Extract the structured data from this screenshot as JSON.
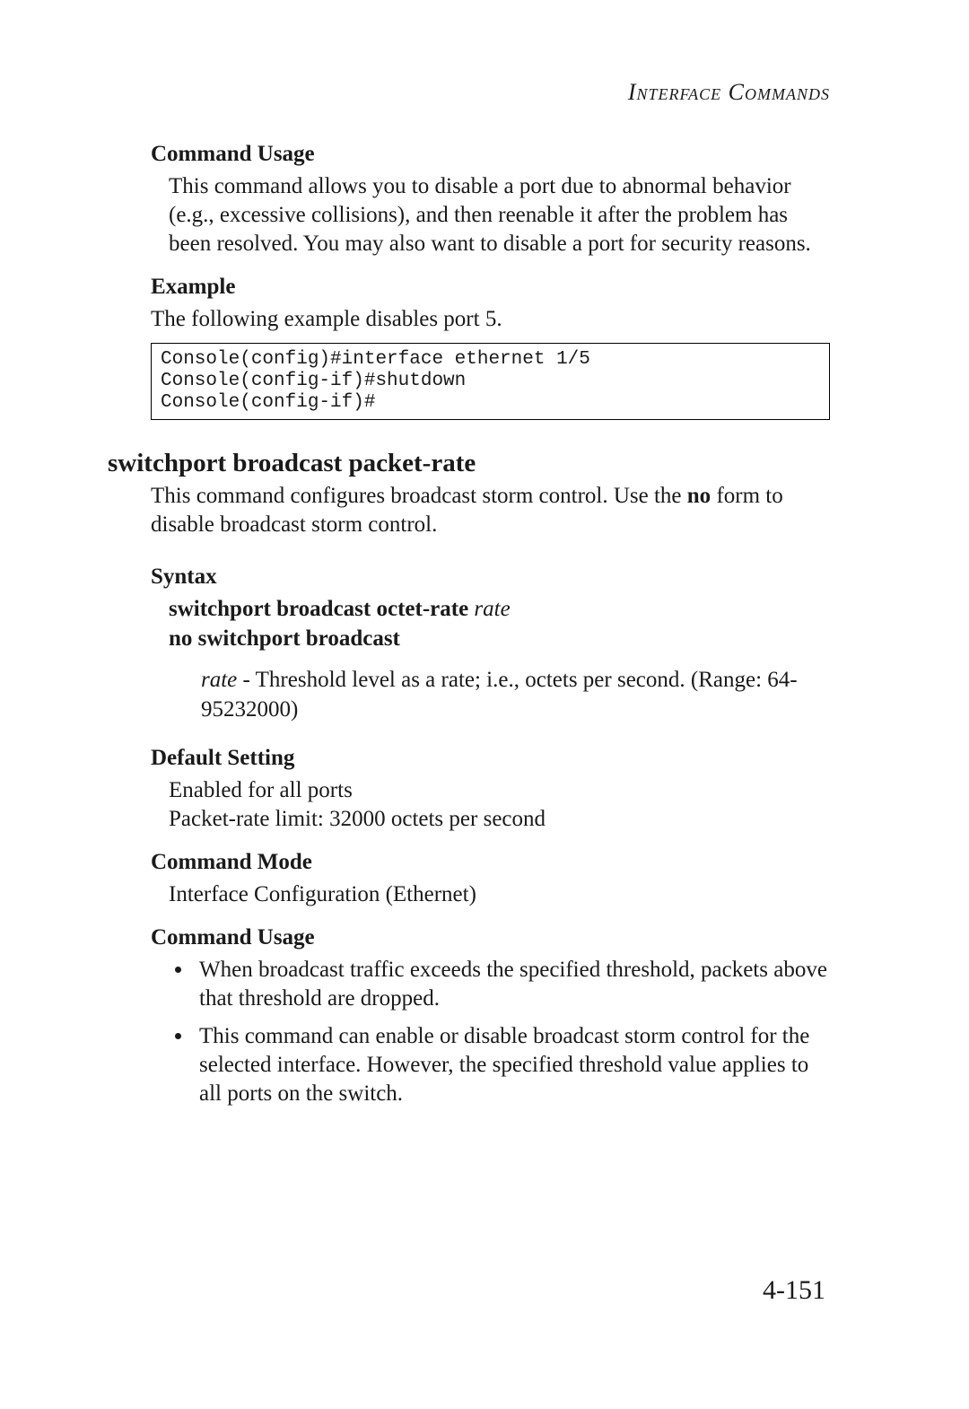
{
  "header": {
    "running": "Interface Commands"
  },
  "sections": {
    "command_usage_1": {
      "heading": "Command Usage",
      "text": "This command allows you to disable a port due to abnormal behavior (e.g., excessive collisions), and then reenable it after the problem has been resolved. You may also want to disable a port for security reasons."
    },
    "example": {
      "heading": "Example",
      "text": "The following example disables port 5.",
      "code": "Console(config)#interface ethernet 1/5\nConsole(config-if)#shutdown\nConsole(config-if)#"
    },
    "cmd_title": "switchport broadcast packet-rate",
    "intro_pre": "This command configures broadcast storm control. Use the ",
    "intro_bold": "no",
    "intro_post": " form to disable broadcast storm control.",
    "syntax": {
      "heading": "Syntax",
      "line1_bold": "switchport broadcast octet-rate",
      "line1_ital": " rate",
      "line2_bold": "no switchport broadcast",
      "rate_ital": "rate",
      "rate_rest": " - Threshold level as a rate; i.e., octets per second. (Range: 64-95232000)"
    },
    "default_setting": {
      "heading": "Default Setting",
      "line1": "Enabled for all ports",
      "line2": "Packet-rate limit: 32000 octets per second"
    },
    "command_mode": {
      "heading": "Command Mode",
      "text": "Interface Configuration (Ethernet)"
    },
    "command_usage_2": {
      "heading": "Command Usage",
      "bullets": [
        "When broadcast traffic exceeds the specified threshold, packets above that threshold are dropped.",
        "This command can enable or disable broadcast storm control for the selected interface. However, the specified threshold value applies to all ports on the switch."
      ]
    }
  },
  "page_number": "4-151"
}
